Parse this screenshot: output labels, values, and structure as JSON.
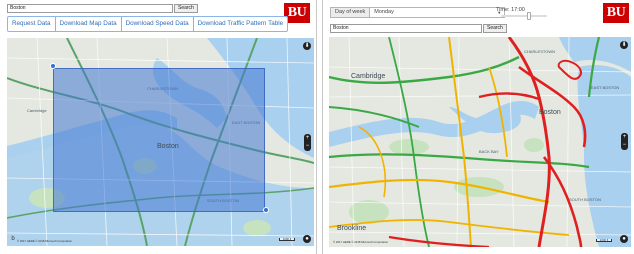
{
  "left_panel": {
    "search": {
      "value": "Boston",
      "button_label": "Search"
    },
    "logo_text": "BU",
    "tabs": [
      {
        "label": "Request Data"
      },
      {
        "label": "Download Map Data"
      },
      {
        "label": "Download Speed Data"
      },
      {
        "label": "Download Traffic Pattern Table"
      }
    ],
    "map": {
      "labels": [
        {
          "text": "Boston",
          "big": true
        },
        {
          "text": "CHARLESTOWN"
        },
        {
          "text": "EAST BOSTON"
        },
        {
          "text": "SOUTH BOSTON"
        },
        {
          "text": "Cambridge"
        }
      ],
      "attribution": "© 2017 HERE © 2018 Microsoft Corporation",
      "scale_text": "1000 ft"
    },
    "selection_color": "#4678d2"
  },
  "right_panel": {
    "dow": {
      "label": "Day of week",
      "value": "Monday"
    },
    "time_label": "Time: 17:00",
    "time_slider": {
      "fraction": 0.62
    },
    "search": {
      "value": "Boston",
      "button_label": "Search"
    },
    "logo_text": "BU",
    "map": {
      "labels": [
        {
          "text": "Cambridge",
          "big": true
        },
        {
          "text": "Boston",
          "big": true
        },
        {
          "text": "CHARLESTOWN"
        },
        {
          "text": "EAST BOSTON"
        },
        {
          "text": "SOUTH BOSTON"
        },
        {
          "text": "Brookline",
          "big": true
        },
        {
          "text": "BACK BAY"
        }
      ],
      "attribution": "© 2017 HERE © 2018 Microsoft Corporation",
      "scale_text": "1000 ft"
    },
    "traffic_colors": {
      "fast": "#3aa845",
      "medium": "#f0b400",
      "slow": "#e02020"
    }
  },
  "colors": {
    "brand": "#cc0000",
    "tab_text": "#2f6fb6",
    "tab_border": "#8bb7e6",
    "water": "#a9d0ee",
    "land": "#e4e8e0",
    "park": "#c7e2bf"
  }
}
